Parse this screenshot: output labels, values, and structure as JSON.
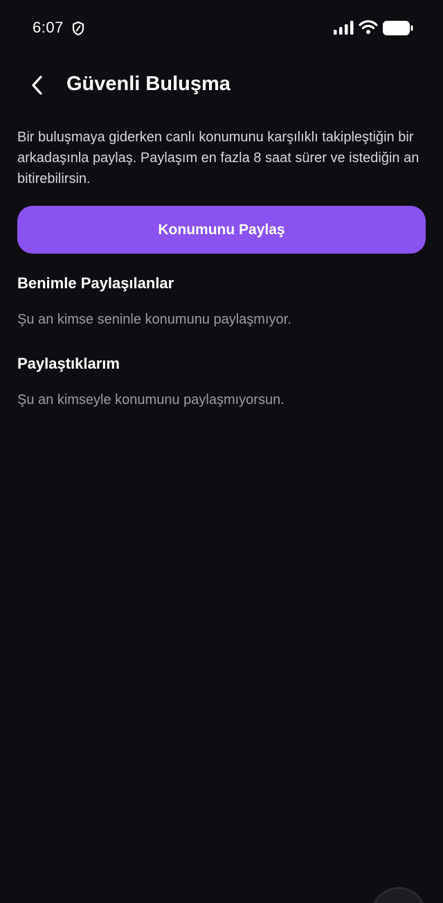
{
  "status_bar": {
    "time": "6:07",
    "icons": [
      "shield-icon",
      "signal-icon",
      "wifi-icon",
      "battery-icon"
    ]
  },
  "header": {
    "back_icon": "chevron-left-icon",
    "title": "Güvenli Buluşma"
  },
  "description": "Bir buluşmaya giderken canlı konumunu karşılıklı takipleştiğin bir arkadaşınla paylaş. Paylaşım en fazla 8 saat sürer ve istediğin an bitirebilirsin.",
  "primary_button": {
    "label": "Konumunu Paylaş"
  },
  "sections": [
    {
      "heading": "Benimle Paylaşılanlar",
      "empty_text": "Şu an kimse seninle konumunu paylaşmıyor."
    },
    {
      "heading": "Paylaştıklarım",
      "empty_text": "Şu an kimseyle konumunu paylaşmıyorsun."
    }
  ],
  "colors": {
    "background": "#0e0e12",
    "accent": "#8a52ee",
    "text_primary": "#ffffff",
    "text_secondary": "#9b9ba6"
  }
}
